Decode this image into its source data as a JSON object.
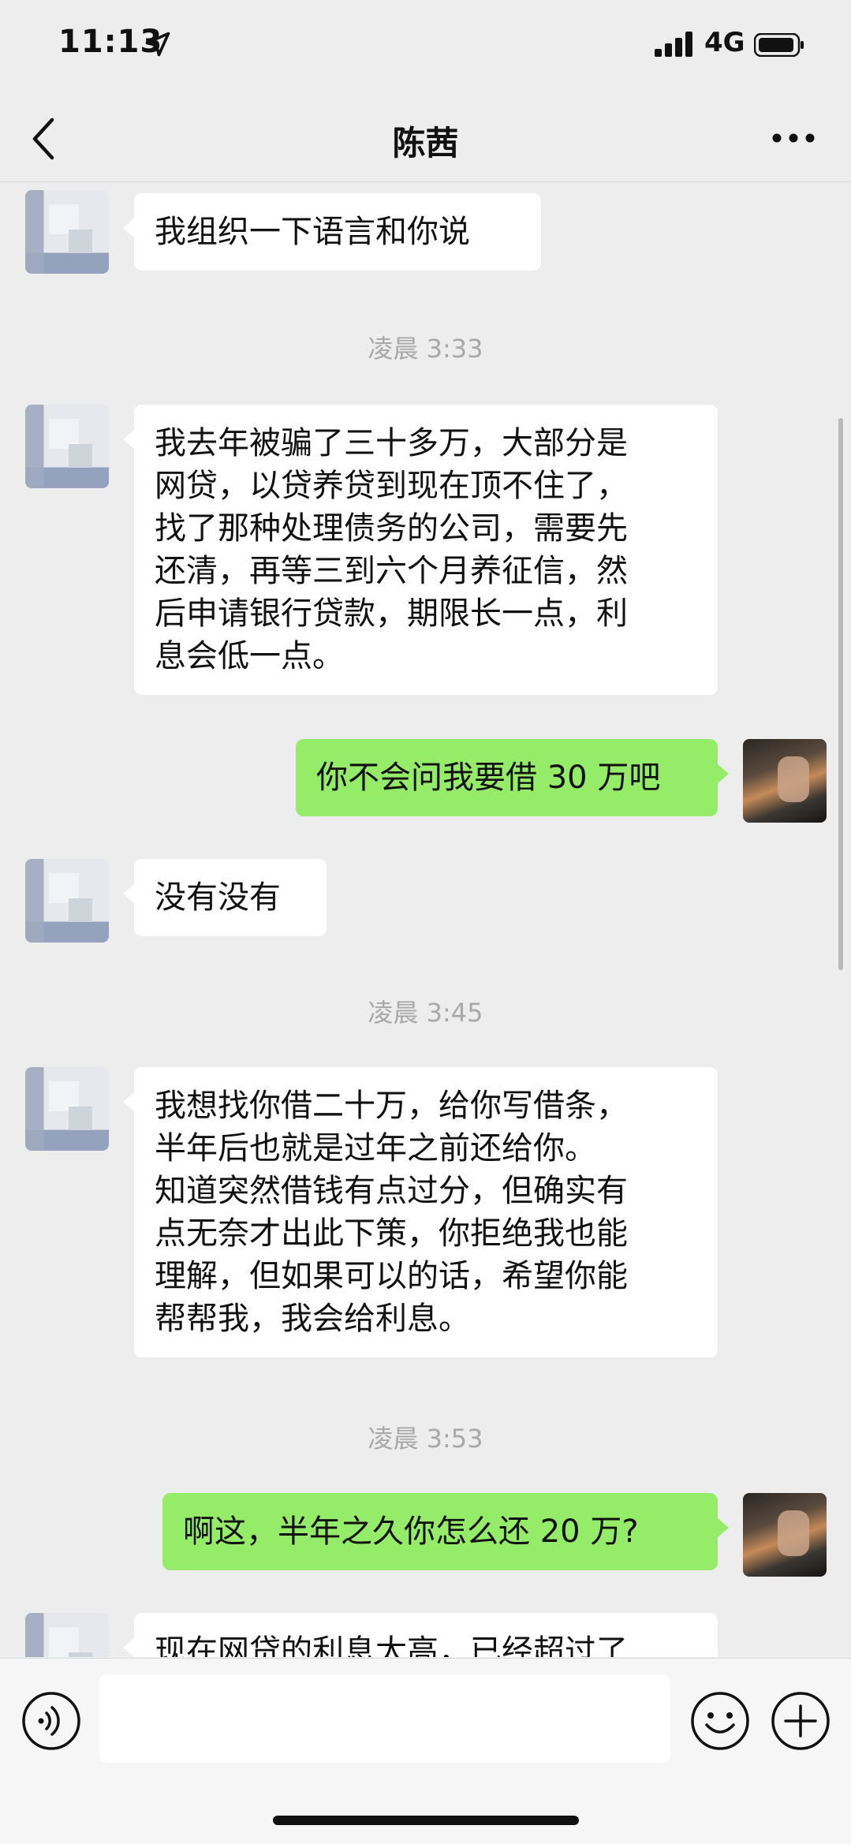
{
  "status_bar": {
    "time": "11:13",
    "network": "4G"
  },
  "nav": {
    "title": "陈茜"
  },
  "messages": [
    {
      "type": "in",
      "text": "我组织一下语言和你说"
    },
    {
      "type": "time",
      "text": "凌晨 3:33"
    },
    {
      "type": "in",
      "text": "我去年被骗了三十多万，大部分是\n网贷，以贷养贷到现在顶不住了，\n找了那种处理债务的公司，需要先\n还清，再等三到六个月养征信，然\n后申请银行贷款，期限长一点，利\n息会低一点。"
    },
    {
      "type": "out",
      "text": "你不会问我要借 30 万吧"
    },
    {
      "type": "in",
      "text": "没有没有"
    },
    {
      "type": "time",
      "text": "凌晨 3:45"
    },
    {
      "type": "in",
      "text": "我想找你借二十万，给你写借条，\n半年后也就是过年之前还给你。\n知道突然借钱有点过分，但确实有\n点无奈才出此下策，你拒绝我也能\n理解，但如果可以的话，希望你能\n帮帮我，我会给利息。"
    },
    {
      "type": "time",
      "text": "凌晨 3:53"
    },
    {
      "type": "out",
      "text": "啊这，半年之久你怎么还 20 万?"
    },
    {
      "type": "in",
      "text": "现在网贷的利息太高，已经超过了"
    }
  ],
  "colors": {
    "outgoing_bubble": "#95ec69",
    "incoming_bubble": "#ffffff",
    "background": "#ededed"
  },
  "icons": {
    "back": "chevron-left-icon",
    "more": "more-dots-icon",
    "voice": "voice-icon",
    "emoji": "emoji-icon",
    "plus": "plus-icon"
  }
}
